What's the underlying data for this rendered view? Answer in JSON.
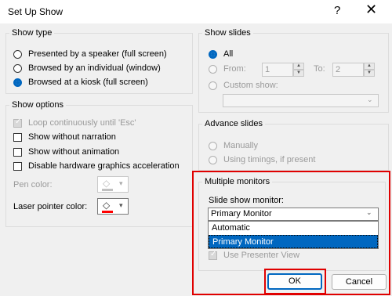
{
  "window": {
    "title": "Set Up Show",
    "help_glyph": "?",
    "close_glyph": "✕"
  },
  "show_type": {
    "legend": "Show type",
    "options": [
      {
        "label": "Presented by a speaker (full screen)",
        "selected": false
      },
      {
        "label": "Browsed by an individual (window)",
        "selected": false
      },
      {
        "label": "Browsed at a kiosk (full screen)",
        "selected": true
      }
    ]
  },
  "show_options": {
    "legend": "Show options",
    "checks": [
      {
        "label": "Loop continuously until 'Esc'",
        "checked": true,
        "disabled": true
      },
      {
        "label": "Show without narration",
        "checked": false,
        "disabled": false
      },
      {
        "label": "Show without animation",
        "checked": false,
        "disabled": false
      },
      {
        "label": "Disable hardware graphics acceleration",
        "checked": false,
        "disabled": false
      }
    ],
    "pen_color_label": "Pen color:",
    "laser_color_label": "Laser pointer color:",
    "pen_color": "#c0c0c0",
    "laser_color": "#ff0000"
  },
  "show_slides": {
    "legend": "Show slides",
    "all_label": "All",
    "from_label": "From:",
    "from_value": "1",
    "to_label": "To:",
    "to_value": "2",
    "custom_label": "Custom show:",
    "custom_value": ""
  },
  "advance_slides": {
    "legend": "Advance slides",
    "manually_label": "Manually",
    "timings_label": "Using timings, if present"
  },
  "monitors": {
    "legend": "Multiple monitors",
    "slide_show_monitor_label": "Slide show monitor:",
    "selected": "Primary Monitor",
    "options": [
      "Automatic",
      "Primary Monitor"
    ],
    "highlighted_index": 1,
    "presenter_view_label": "Use Presenter View"
  },
  "buttons": {
    "ok": "OK",
    "cancel": "Cancel"
  },
  "colors": {
    "accent": "#0067c0",
    "highlight_border": "#e00000",
    "selection_bg": "#0067c0"
  }
}
